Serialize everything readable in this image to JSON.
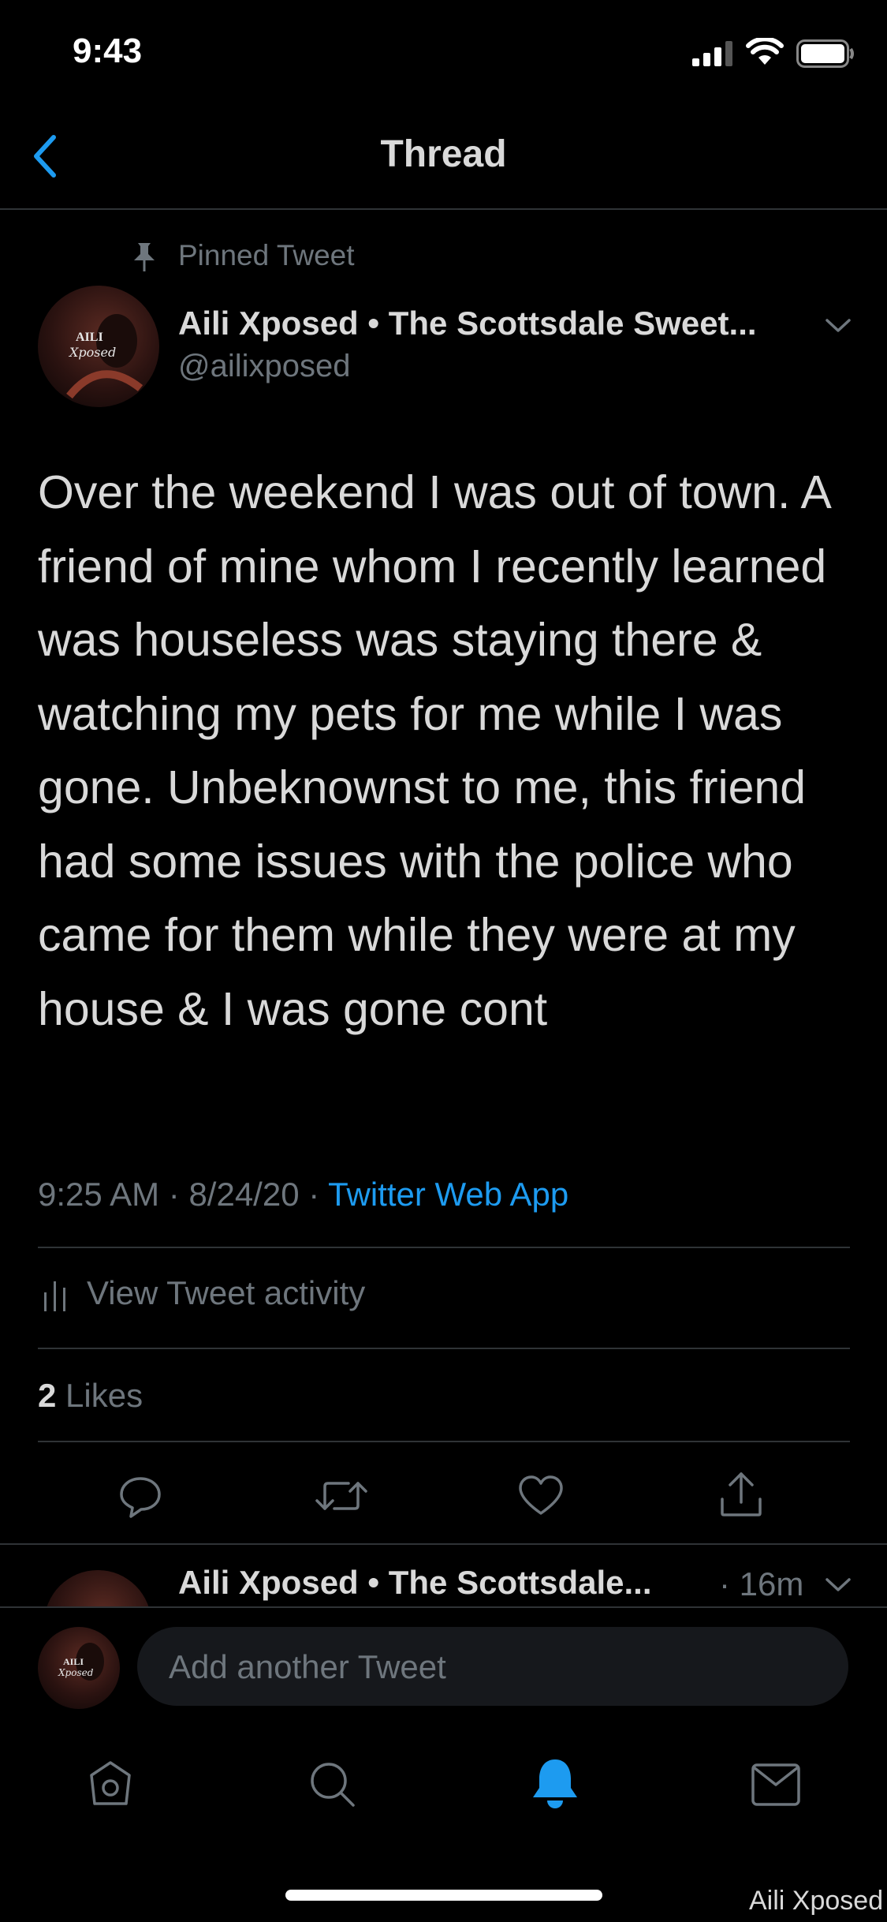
{
  "status_bar": {
    "time": "9:43",
    "icons": [
      "signal-icon",
      "wifi-icon",
      "battery-icon"
    ]
  },
  "nav": {
    "back_icon": "chevron-left-icon",
    "title": "Thread"
  },
  "pinned_label": "Pinned Tweet",
  "tweet": {
    "author_name": "Aili Xposed • The Scottsdale Sweet...",
    "handle": "@ailixposed",
    "avatar_text": "AILI Xposed",
    "body": "Over the weekend I was out of town. A friend of mine whom I recently learned was houseless was staying there & watching my pets for me while I was gone. Unbeknownst to me, this friend had some issues with the police who came for them while they were at my house & I was gone cont",
    "time": "9:25 AM",
    "date": "8/24/20",
    "source": "Twitter Web App",
    "view_activity": "View Tweet activity",
    "likes_count": "2",
    "likes_label": "Likes"
  },
  "reply_preview": {
    "author_name": "Aili Xposed • The Scottsdale...",
    "age": "· 16m"
  },
  "composer": {
    "placeholder": "Add another Tweet"
  },
  "tab_bar": {
    "items": [
      "home-icon",
      "search-icon",
      "notifications-icon",
      "messages-icon"
    ],
    "active": "notifications-icon"
  },
  "watermark": "Aili Xposed",
  "colors": {
    "background": "#000000",
    "text": "#d9d9d9",
    "muted": "#6e767d",
    "accent": "#1d9bf0",
    "divider": "#2f3336"
  }
}
